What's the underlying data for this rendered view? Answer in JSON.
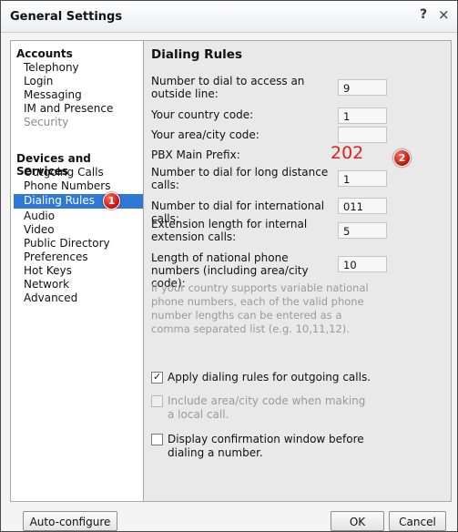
{
  "window": {
    "title": "General Settings",
    "help_glyph": "?",
    "close_glyph": "×"
  },
  "sidebar": {
    "accounts_header": "Accounts",
    "accounts_items": [
      "Telephony",
      "Login",
      "Messaging",
      "IM and Presence",
      "Security"
    ],
    "devices_header": "Devices and Services",
    "devices_items": [
      "Outgoing Calls",
      "Phone Numbers",
      "Dialing Rules",
      "Audio",
      "Video",
      "Public Directory",
      "Preferences",
      "Hot Keys",
      "Network",
      "Advanced"
    ],
    "selected": "Dialing Rules"
  },
  "content": {
    "title": "Dialing Rules",
    "fields": [
      {
        "label": "Number to dial to access an outside line:",
        "value": "9"
      },
      {
        "label": "Your country code:",
        "value": "1"
      },
      {
        "label": "Your area/city code:",
        "value": ""
      },
      {
        "label": "PBX Main Prefix:",
        "value": "202"
      },
      {
        "label": "Number to dial for long distance calls:",
        "value": "1"
      },
      {
        "label": "Number to dial for international calls:",
        "value": "011"
      },
      {
        "label": "Extension length for internal extension calls:",
        "value": "5"
      },
      {
        "label": "Length of national phone numbers (including area/city code):",
        "value": "10"
      }
    ],
    "note": "If your country supports variable national phone numbers, each of the valid phone number lengths can be entered as a comma separated list (e.g. 10,11,12).",
    "checkboxes": [
      {
        "label": "Apply dialing rules for outgoing calls.",
        "checked": true,
        "enabled": true
      },
      {
        "label": "Include area/city code when making a local call.",
        "checked": false,
        "enabled": false
      },
      {
        "label": "Display confirmation window before dialing a number.",
        "checked": false,
        "enabled": true
      }
    ]
  },
  "badges": {
    "one": "1",
    "two": "2",
    "color": "#d0150d"
  },
  "footer": {
    "auto_configure": "Auto-configure",
    "ok": "OK",
    "cancel": "Cancel"
  }
}
